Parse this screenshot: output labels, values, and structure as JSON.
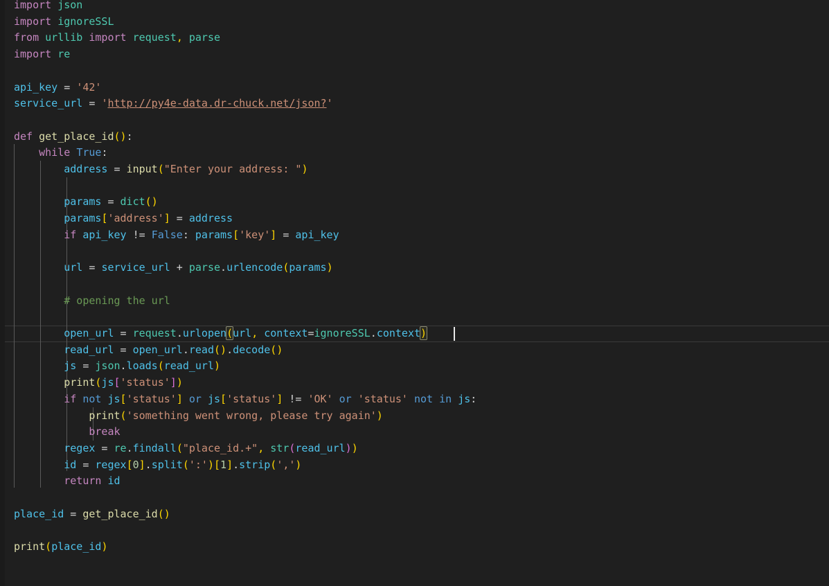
{
  "editor": {
    "language": "python",
    "theme_name": "dark-plus",
    "background_color": "#1f1f1f",
    "gutter_color": "#1b1b1b",
    "font_size_px": 15,
    "line_height_px": 23.7,
    "cursor": {
      "line_index": 19,
      "column": 56,
      "color": "#e8e8e8"
    },
    "current_line_index": 19,
    "bracket_match": {
      "open_char": "(",
      "close_char": ")",
      "outline_color": "#888871"
    },
    "token_colors": {
      "keyword": "#c586c0",
      "module": "#4ec9b0",
      "variable": "#4fc1e9",
      "function": "#dcdcaa",
      "string": "#ce9178",
      "comment": "#6a9955",
      "constant": "#569cd6",
      "operator": "#d4d4d4",
      "bracket_level_1": "#ffd700",
      "bracket_level_2": "#da70d6",
      "bracket_level_3": "#179fff",
      "indent_guide": "#5a5a5a"
    }
  },
  "code": {
    "lines": [
      "import json",
      "import ignoreSSL",
      "from urllib import request, parse",
      "import re",
      "",
      "api_key = '42'",
      "service_url = 'http://py4e-data.dr-chuck.net/json?'",
      "",
      "def get_place_id():",
      "    while True:",
      "        address = input(\"Enter your address: \")",
      "",
      "        params = dict()",
      "        params['address'] = address",
      "        if api_key != False: params['key'] = api_key",
      "",
      "        url = service_url + parse.urlencode(params)",
      "",
      "        # opening the url",
      "",
      "        open_url = request.urlopen(url, context=ignoreSSL.context)",
      "        read_url = open_url.read().decode()",
      "        js = json.loads(read_url)",
      "        print(js['status'])",
      "        if not js['status'] or js['status'] != 'OK' or 'status' not in js:",
      "            print('something went wrong, please try again')",
      "            break",
      "        regex = re.findall(\"place_id.+\", str(read_url))",
      "        id = regex[0].split(':')[1].strip(',')",
      "        return id",
      "",
      "place_id = get_place_id()",
      "",
      "print(place_id)"
    ],
    "line_count": 33,
    "url_literal": "http://py4e-data.dr-chuck.net/json?",
    "api_key_value": "42",
    "comment_text": "# opening the url",
    "prompt_text": "Enter your address: ",
    "error_message": "something went wrong, please try again",
    "regex_pattern": "place_id.+",
    "function_name": "get_place_id"
  }
}
